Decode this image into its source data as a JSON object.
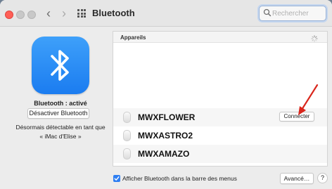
{
  "titlebar": {
    "title": "Bluetooth",
    "back_icon": "chevron-left-icon",
    "forward_icon": "chevron-right-icon",
    "grid_icon": "show-all-grid-icon"
  },
  "search": {
    "placeholder": "Rechercher",
    "value": ""
  },
  "left_panel": {
    "status": "Bluetooth : activé",
    "toggle_button": "Désactiver Bluetooth",
    "discoverable_line1": "Désormais détectable en tant que",
    "discoverable_line2": "« iMac d'Elise »",
    "icon": "bluetooth-icon",
    "icon_color": "#1b7cf0"
  },
  "devices": {
    "header": "Appareils",
    "items": [
      {
        "name": "MWXFLOWER",
        "action": "Connecter",
        "icon": "earbud-icon"
      },
      {
        "name": "MWXASTRO2",
        "icon": "earbud-icon"
      },
      {
        "name": "MWXAMAZO",
        "icon": "earbud-icon"
      }
    ]
  },
  "footer": {
    "menu_bar_checkbox_label": "Afficher Bluetooth dans la barre des menus",
    "menu_bar_checked": true,
    "advanced_button": "Avancé…",
    "help_button": "?"
  },
  "colors": {
    "accent": "#2f7ff2",
    "close_button": "#ff5f57",
    "annotation_arrow": "#d9261c"
  }
}
